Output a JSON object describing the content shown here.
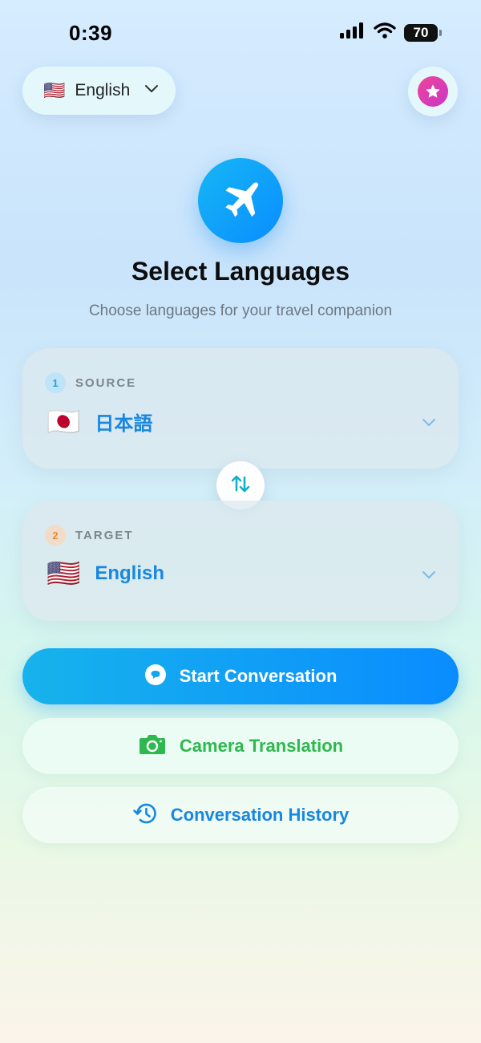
{
  "status_bar": {
    "time": "0:39",
    "battery": "70"
  },
  "header": {
    "ui_language": {
      "flag": "🇺🇸",
      "label": "English"
    },
    "icons": {
      "premium": "star-icon"
    }
  },
  "hero": {
    "icon": "airplane-icon",
    "title": "Select Languages",
    "subtitle": "Choose languages for your travel companion"
  },
  "source": {
    "step": "1",
    "label": "SOURCE",
    "flag": "🇯🇵",
    "language": "日本語"
  },
  "target": {
    "step": "2",
    "label": "TARGET",
    "flag": "🇺🇸",
    "language": "English"
  },
  "actions": {
    "start": "Start Conversation",
    "camera": "Camera Translation",
    "history": "Conversation History"
  },
  "colors": {
    "accent": "#0a8cff",
    "green": "#2fb84f",
    "pink": "#f0449a"
  }
}
